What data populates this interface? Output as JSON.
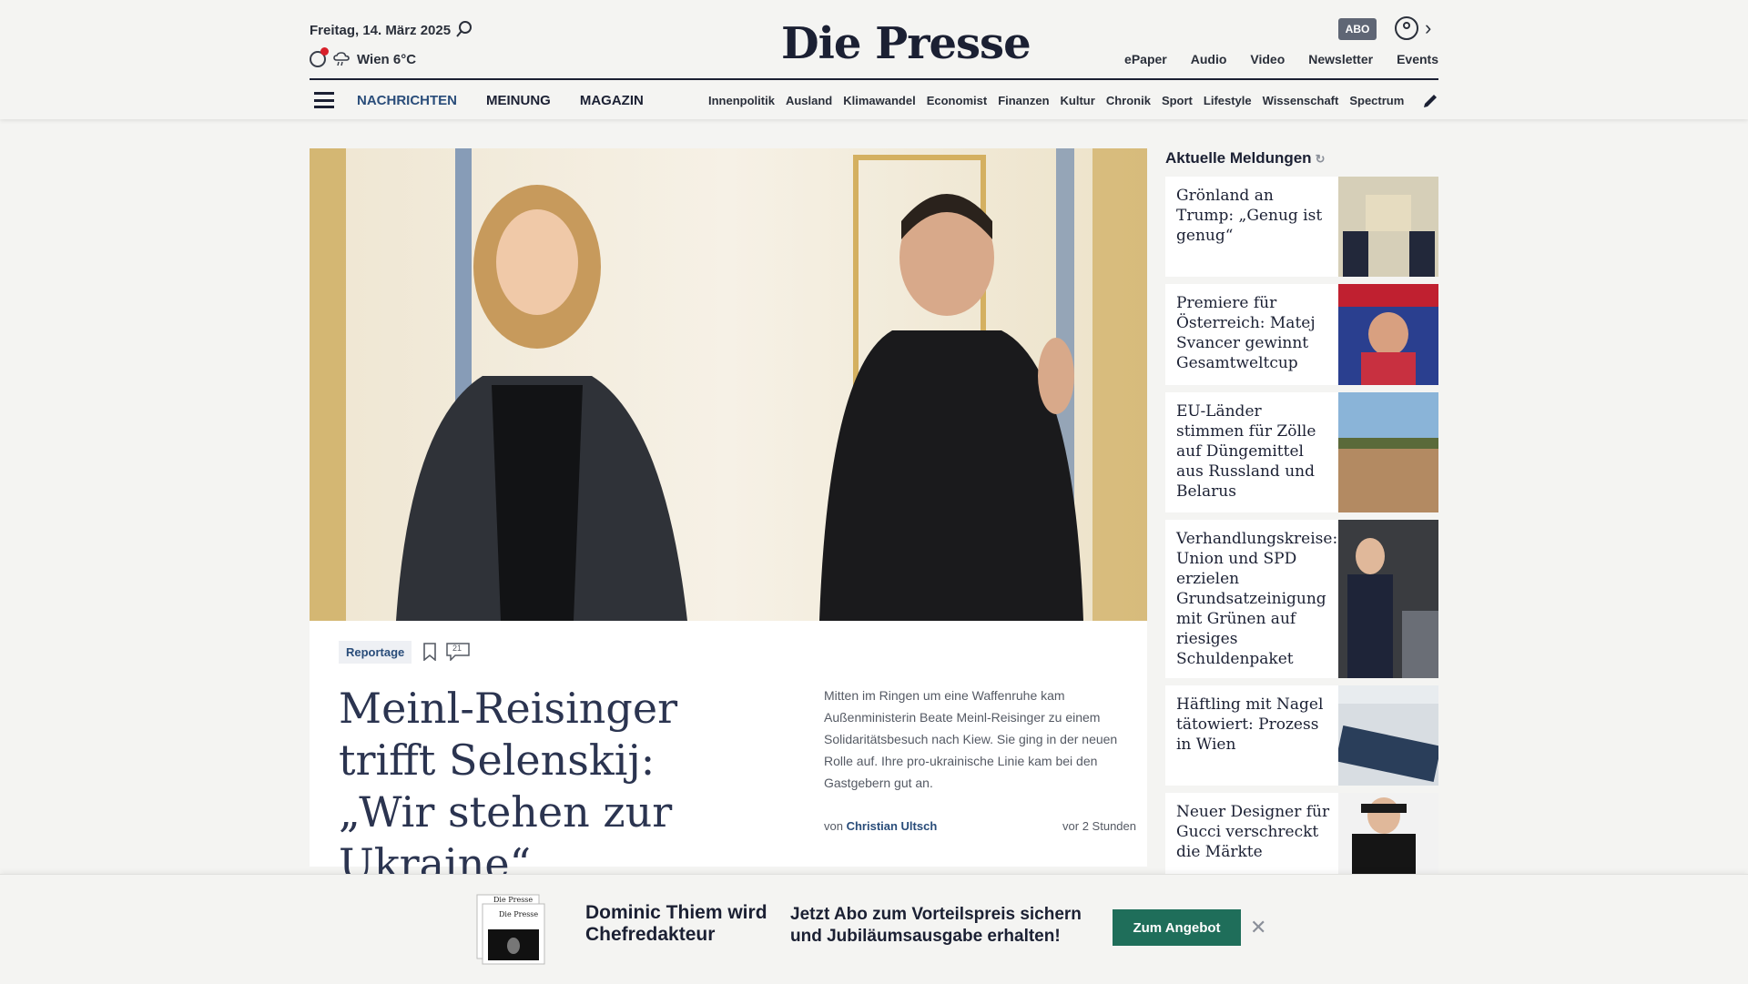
{
  "header": {
    "date": "Freitag, 14. März 2025",
    "weather": "Wien 6°C",
    "logo": "Die Presse",
    "abo": "ABO",
    "top_links": [
      "ePaper",
      "Audio",
      "Video",
      "Newsletter",
      "Events"
    ]
  },
  "nav": {
    "main": [
      "NACHRICHTEN",
      "MEINUNG",
      "MAGAZIN"
    ],
    "sub": [
      "Innenpolitik",
      "Ausland",
      "Klimawandel",
      "Economist",
      "Finanzen",
      "Kultur",
      "Chronik",
      "Sport",
      "Lifestyle",
      "Wissenschaft",
      "Spectrum"
    ]
  },
  "hero": {
    "category": "Reportage",
    "comments": "21",
    "headline": "Meinl-Reisinger trifft Selenskij: „Wir stehen zur Ukraine“",
    "teaser": "Mitten im Ringen um eine Waffenruhe kam Außenministerin Beate Meinl-Reisinger zu einem Solidaritätsbesuch nach Kiew. Sie ging in der neuen Rolle auf. Ihre pro-ukrainische Linie kam bei den Gastgebern gut an.",
    "byline_prefix": "von",
    "author": "Christian Ultsch",
    "time": "vor 2 Stunden"
  },
  "sidebar": {
    "title": "Aktuelle Meldungen",
    "items": [
      {
        "title": "Grönland an Trump: „Genug ist genug“"
      },
      {
        "title": "Premiere für Österreich: Matej Svancer gewinnt Gesamtweltcup"
      },
      {
        "title": "EU-Länder stimmen für Zölle auf Düngemittel aus Russland und Belarus"
      },
      {
        "title": "Verhandlungskreise: Union und SPD erzielen Grundsatzeinigung mit Grünen auf riesiges Schuldenpaket"
      },
      {
        "title": "Häftling mit Nagel tätowiert: Prozess in Wien"
      },
      {
        "title": "Neuer Designer für Gucci verschreckt die Märkte"
      }
    ]
  },
  "banner": {
    "left": "Dominic Thiem wird Chefredakteur",
    "middle": "Jetzt Abo zum Vorteilspreis sichern und Jubiläumsausgabe erhalten!",
    "button": "Zum Angebot",
    "paper_logo": "Die Presse"
  }
}
